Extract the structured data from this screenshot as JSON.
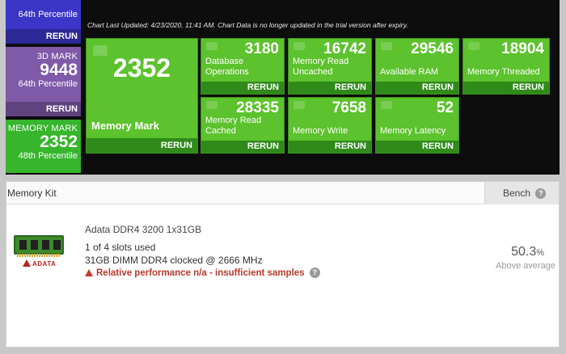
{
  "left_stats": [
    {
      "label": "",
      "value": "",
      "percentile": "64th Percentile",
      "rerun": "RERUN"
    },
    {
      "label": "3D MARK",
      "value": "9448",
      "percentile": "64th Percentile",
      "rerun": "RERUN"
    },
    {
      "label": "MEMORY MARK",
      "value": "2352",
      "percentile": "48th Percentile"
    }
  ],
  "chart_note": "Chart Last Updated: 4/23/2020, 11:41 AM. Chart Data is no longer updated in the trial version after expiry.",
  "memory_mark": {
    "value": "2352",
    "label": "Memory Mark",
    "rerun": "RERUN"
  },
  "tiles": [
    {
      "value": "3180",
      "label_1": "Database",
      "label_2": "Operations",
      "rerun": "RERUN"
    },
    {
      "value": "16742",
      "label_1": "Memory Read",
      "label_2": "Uncached",
      "rerun": "RERUN"
    },
    {
      "value": "29546",
      "label_1": "",
      "label_2": "Available RAM",
      "rerun": "RERUN"
    },
    {
      "value": "18904",
      "label_1": "",
      "label_2": "Memory Threaded",
      "rerun": "RERUN"
    },
    {
      "value": "28335",
      "label_1": "Memory Read",
      "label_2": "Cached",
      "rerun": "RERUN"
    },
    {
      "value": "7658",
      "label_1": "",
      "label_2": "Memory Write",
      "rerun": "RERUN"
    },
    {
      "value": "52",
      "label_1": "",
      "label_2": "Memory Latency",
      "rerun": "RERUN"
    }
  ],
  "kit": {
    "header": "Memory Kit",
    "bench_label": "Bench",
    "name": "Adata DDR4 3200 1x31GB",
    "slots": "1 of 4 slots used",
    "description": "31GB DIMM DDR4 clocked @ 2666 MHz",
    "warning": "Relative performance n/a - insufficient samples",
    "score_value": "50.3",
    "score_unit": "%",
    "score_label": "Above average",
    "logo_text": "ADATA"
  },
  "colors": {
    "tile_green": "#5cc22d",
    "tile_dark": "#2f8a1a",
    "warning": "#b83a2a",
    "blue_stat": "#3b36c7",
    "purple_stat": "#7e5aa8"
  },
  "icons": [
    "ram-stick-icon",
    "adata-logo-icon",
    "warning-icon",
    "help-icon"
  ]
}
